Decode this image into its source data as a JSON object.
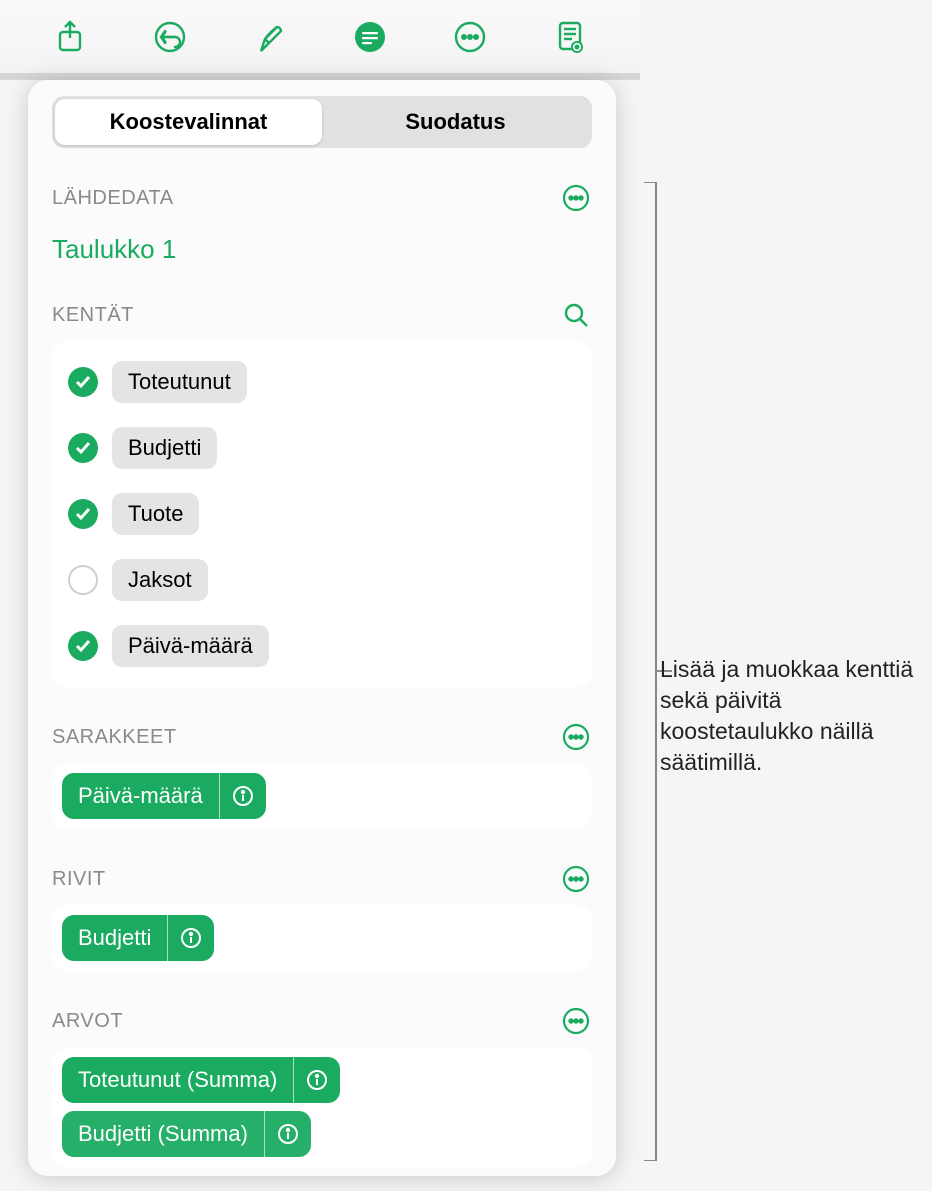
{
  "toolbar": {
    "icons": [
      "share-icon",
      "undo-icon",
      "format-icon",
      "organize-icon",
      "more-icon",
      "preview-icon"
    ]
  },
  "tabs": {
    "pivot": "Koostevalinnat",
    "filter": "Suodatus"
  },
  "source": {
    "label": "LÄHDEDATA",
    "table": "Taulukko 1"
  },
  "fields": {
    "label": "KENTÄT",
    "items": [
      {
        "name": "Toteutunut",
        "checked": true
      },
      {
        "name": "Budjetti",
        "checked": true
      },
      {
        "name": "Tuote",
        "checked": true
      },
      {
        "name": "Jaksot",
        "checked": false
      },
      {
        "name": "Päivä-määrä",
        "checked": true
      }
    ]
  },
  "columns": {
    "label": "SARAKKEET",
    "pills": [
      "Päivä-määrä"
    ]
  },
  "rows": {
    "label": "RIVIT",
    "pills": [
      "Budjetti"
    ]
  },
  "values": {
    "label": "ARVOT",
    "pills": [
      "Toteutunut (Summa)",
      "Budjetti (Summa)"
    ]
  },
  "callout": "Lisää ja muokkaa kenttiä sekä päivitä koostetaulukko näillä säätimillä."
}
